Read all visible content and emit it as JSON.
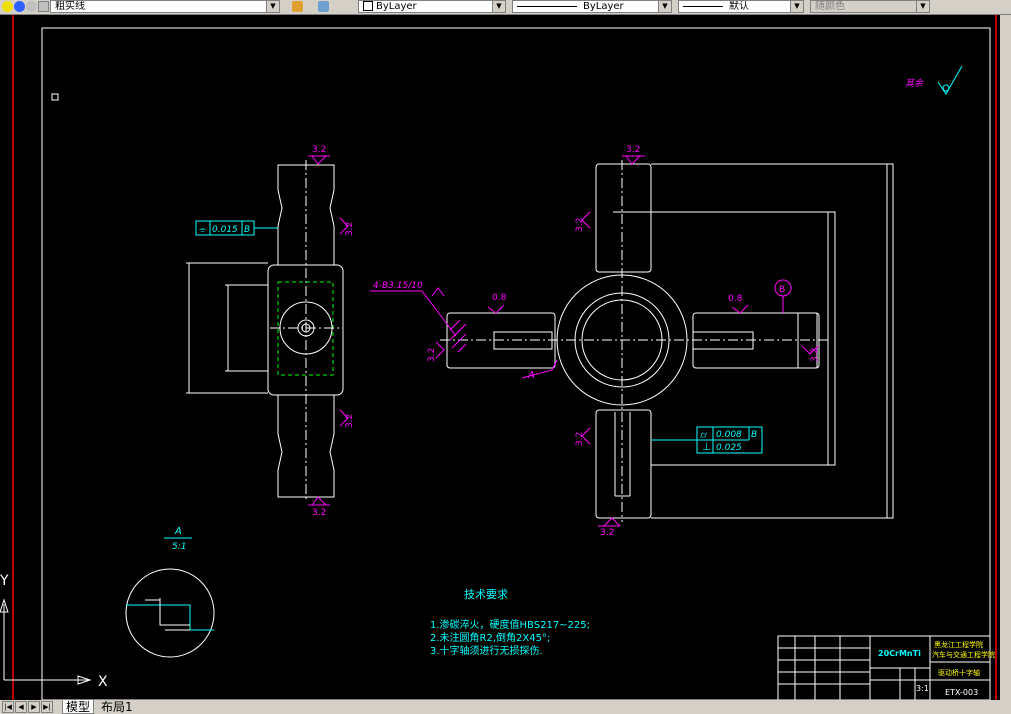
{
  "toolbar": {
    "layer_name": "粗实线",
    "color": "ByLayer",
    "linetype": "ByLayer",
    "lineweight": "默认",
    "plotstyle": "随颜色"
  },
  "drawing": {
    "tolerance_flatness": "0.015",
    "datum_b": "B",
    "holes_note": "4-B3.15/10",
    "section_label": "A",
    "section_title": "A",
    "section_scale": "5:1",
    "roughness_labels": [
      "3.2",
      "3.2",
      "3.2",
      "3.2",
      "3.2",
      "3.2",
      "3.2",
      "3.2",
      "0.8",
      "0.8",
      "3.2",
      "3.2"
    ],
    "tolerance_pos": "0.008",
    "tolerance_pos_datum": "B",
    "tolerance_perp": "0.025",
    "tech_title": "技术要求",
    "tech_lines": [
      "1.渗碳淬火，硬度值HBS217~225;",
      "2.未注圆角R2,倒角2X45°;",
      "3.十字轴须进行无损探伤."
    ],
    "title_block": {
      "material": "20CrMnTi",
      "school": "黑龙江工程学院",
      "dept": "汽车与交通工程学院",
      "part_name": "驱动桥十字轴",
      "scale": "3:1",
      "drawing_no": "ETX-003"
    }
  },
  "bottom": {
    "tab_model": "模型",
    "tab_layout": "布局1"
  },
  "colors": {
    "magenta": "#ff00ff",
    "cyan": "#00ffff",
    "white": "#ffffff",
    "red": "#ff0000",
    "green": "#00ff00"
  }
}
